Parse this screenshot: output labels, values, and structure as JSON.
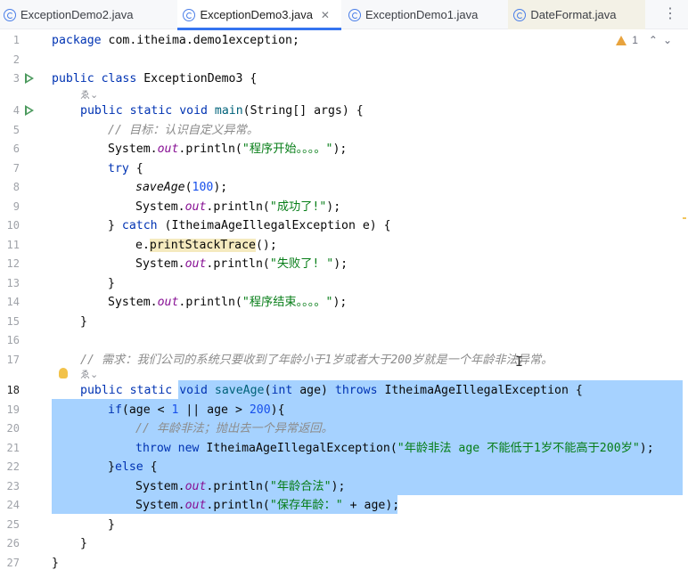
{
  "tabs": [
    {
      "label": "ExceptionDemo2.java",
      "active": false
    },
    {
      "label": "ExceptionDemo3.java",
      "active": true
    },
    {
      "label": "ExceptionDemo1.java",
      "active": false
    },
    {
      "label": "DateFormat.java",
      "active": false
    }
  ],
  "tab_more_icon": "more-vertical-icon",
  "inspection": {
    "warning_count": "1",
    "up_arrow": "⌃",
    "down_arrow": "⌄"
  },
  "line_numbers": [
    "1",
    "2",
    "3",
    "4",
    "5",
    "6",
    "7",
    "8",
    "9",
    "10",
    "11",
    "12",
    "13",
    "14",
    "15",
    "16",
    "17",
    "18",
    "19",
    "20",
    "21",
    "22",
    "23",
    "24",
    "25",
    "26",
    "27"
  ],
  "current_line": "18",
  "inlay_hints": {
    "line3": "ゑ⌄",
    "line17": "ゑ⌄"
  },
  "code": {
    "l1": {
      "kw": "package",
      "rest": " com.itheima.demo1exception;"
    },
    "l3": {
      "kw1": "public",
      "kw2": "class",
      "name": " ExceptionDemo3 {"
    },
    "l4": {
      "kw1": "public",
      "kw2": "static",
      "kw3": "void",
      "method": "main",
      "rest": "(String[] args) {"
    },
    "l5": {
      "comment": "// 目标：认识自定义异常。"
    },
    "l6": {
      "pre": "System.",
      "field": "out",
      "mid": ".println(",
      "str": "\"程序开始。。。。\"",
      "post": ");"
    },
    "l7": {
      "kw": "try",
      "post": " {"
    },
    "l8": {
      "call": "saveAge",
      "open": "(",
      "num": "100",
      "post": ");"
    },
    "l9": {
      "pre": "System.",
      "field": "out",
      "mid": ".println(",
      "str": "\"成功了!\"",
      "post": ");"
    },
    "l10": {
      "pre": "} ",
      "kw": "catch",
      "post": " (ItheimaAgeIllegalException e) {"
    },
    "l11": {
      "pre": "e.",
      "call": "printStackTrace",
      "post": "();"
    },
    "l12": {
      "pre": "System.",
      "field": "out",
      "mid": ".println(",
      "str": "\"失败了! \"",
      "post": ");"
    },
    "l13": {
      "text": "}"
    },
    "l14": {
      "pre": "System.",
      "field": "out",
      "mid": ".println(",
      "str": "\"程序结束。。。。\"",
      "post": ");"
    },
    "l15": {
      "text": "}"
    },
    "l17": {
      "comment": "// 需求：我们公司的系统只要收到了年龄小于1岁或者大于200岁就是一个年龄非法异常。"
    },
    "l18": {
      "kw1": "public",
      "kw2": "static",
      "kw3": "void",
      "method": "saveAge",
      "open": "(",
      "kw4": "int",
      "args": " age) ",
      "kw5": "throws",
      "post": " ItheimaAgeIllegalException {"
    },
    "l19": {
      "kw": "if",
      "a": "(age < ",
      "n1": "1",
      "b": " || age > ",
      "n2": "200",
      "c": "){"
    },
    "l20": {
      "comment": "// 年龄非法；抛出去一个异常返回。"
    },
    "l21": {
      "kw1": "throw",
      "kw2": "new",
      "mid": " ItheimaAgeIllegalException(",
      "str": "\"年龄非法 age 不能低于1岁不能高于200岁\"",
      "post": ");"
    },
    "l22": {
      "pre": "}",
      "kw": "else",
      "post": " {"
    },
    "l23": {
      "pre": "System.",
      "field": "out",
      "mid": ".println(",
      "str": "\"年龄合法\"",
      "post": ");"
    },
    "l24": {
      "pre": "System.",
      "field": "out",
      "mid": ".println(",
      "str": "\"保存年龄：\"",
      "post": " + age);"
    },
    "l25": {
      "text": "}"
    },
    "l26": {
      "text": "}"
    },
    "l27": {
      "text": "}"
    }
  }
}
